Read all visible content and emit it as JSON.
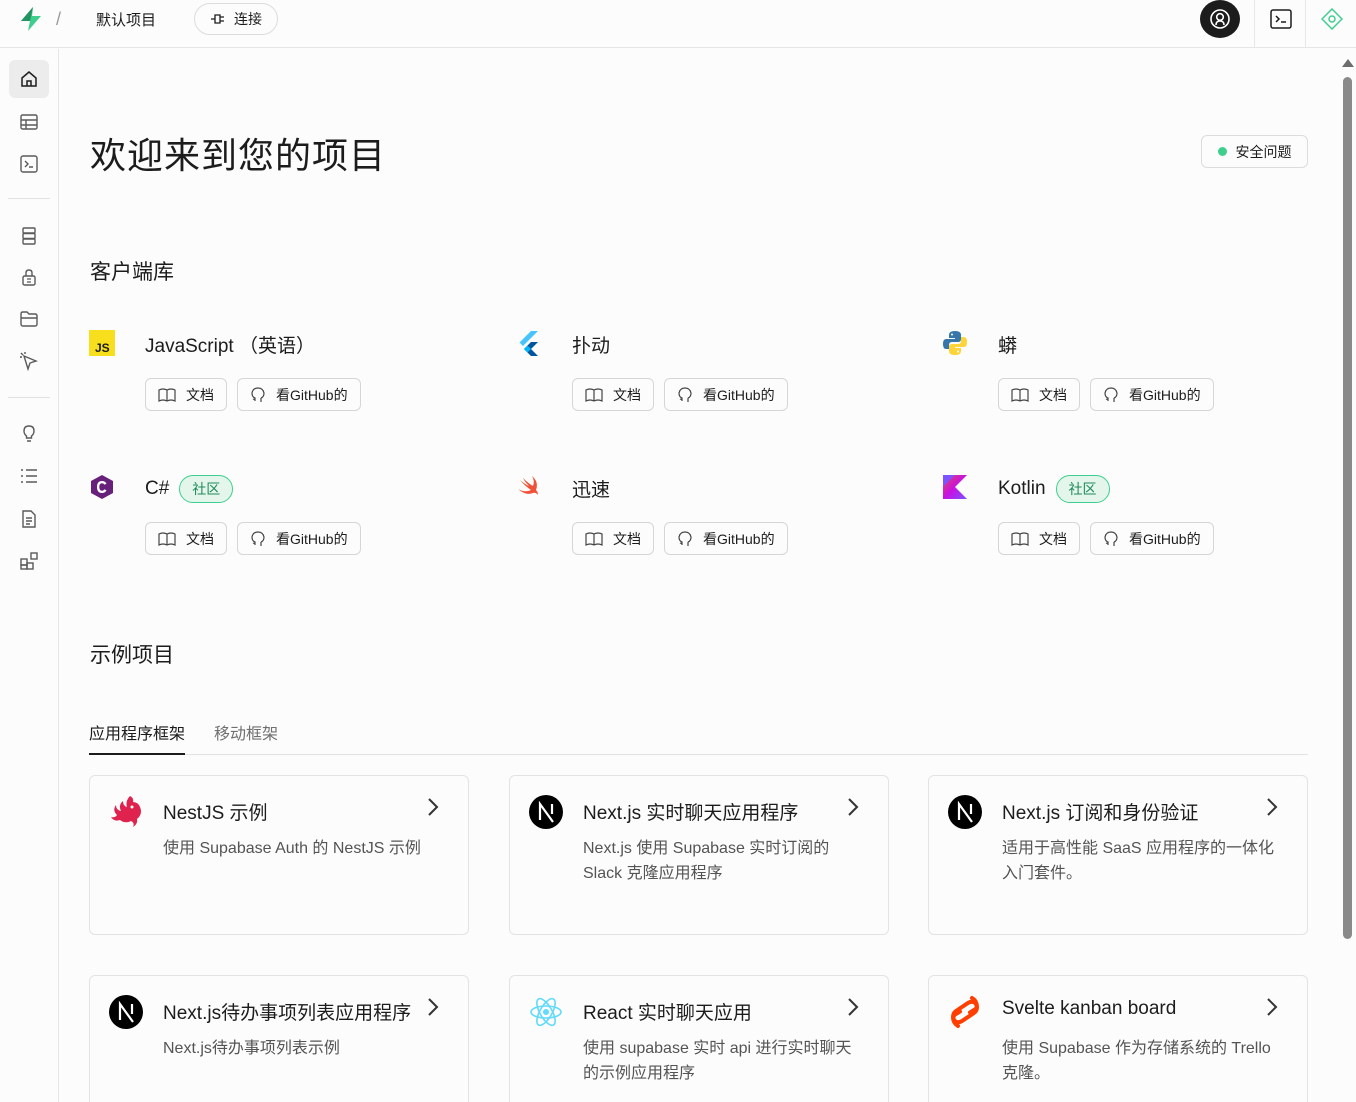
{
  "topbar": {
    "separator": "/",
    "project_name": "默认项目",
    "connect_label": "连接",
    "icons": [
      "supabase-logo",
      "plug-icon",
      "user-avatar-icon",
      "terminal-icon",
      "diamond-icon"
    ]
  },
  "sidebar": {
    "items": [
      {
        "name": "home",
        "icon": "home-icon",
        "active": true
      },
      {
        "name": "table-editor",
        "icon": "table-icon"
      },
      {
        "name": "sql-editor",
        "icon": "terminal-icon"
      },
      {
        "name": "database",
        "icon": "database-icon"
      },
      {
        "name": "authentication",
        "icon": "lock-icon"
      },
      {
        "name": "storage",
        "icon": "folder-icon"
      },
      {
        "name": "realtime",
        "icon": "cursor-icon"
      },
      {
        "name": "advisors",
        "icon": "lightbulb-icon"
      },
      {
        "name": "logs",
        "icon": "list-icon"
      },
      {
        "name": "api-docs",
        "icon": "document-icon"
      },
      {
        "name": "integrations",
        "icon": "blocks-icon"
      }
    ]
  },
  "main": {
    "title": "欢迎来到您的项目",
    "security_label": "安全问题",
    "client_libraries_title": "客户端库",
    "docs_label": "文档",
    "github_label": "看GitHub的",
    "community_label": "社区",
    "libraries": [
      {
        "name": "JavaScript （英语）",
        "icon": "javascript-icon",
        "community": false
      },
      {
        "name": "扑动",
        "icon": "flutter-icon",
        "community": false
      },
      {
        "name": "蟒",
        "icon": "python-icon",
        "community": false
      },
      {
        "name": "C#",
        "icon": "csharp-icon",
        "community": true
      },
      {
        "name": "迅速",
        "icon": "swift-icon",
        "community": false
      },
      {
        "name": "Kotlin",
        "icon": "kotlin-icon",
        "community": true
      }
    ],
    "examples_title": "示例项目",
    "tabs": [
      {
        "label": "应用程序框架",
        "active": true
      },
      {
        "label": "移动框架",
        "active": false
      }
    ],
    "examples": [
      {
        "title": "NestJS 示例",
        "desc": "使用 Supabase Auth 的 NestJS 示例",
        "icon": "nestjs-icon"
      },
      {
        "title": "Next.js 实时聊天应用程序",
        "desc": "Next.js 使用 Supabase 实时订阅的 Slack 克隆应用程序",
        "icon": "nextjs-icon"
      },
      {
        "title": "Next.js 订阅和身份验证",
        "desc": "适用于高性能 SaaS 应用程序的一体化入门套件。",
        "icon": "nextjs-icon"
      },
      {
        "title": "Next.js待办事项列表应用程序",
        "desc": "Next.js待办事项列表示例",
        "icon": "nextjs-icon"
      },
      {
        "title": "React 实时聊天应用",
        "desc": "使用 supabase 实时 api 进行实时聊天的示例应用程序",
        "icon": "react-icon"
      },
      {
        "title": "Svelte kanban board",
        "desc": "使用 Supabase 作为存储系统的 Trello 克隆。",
        "icon": "svelte-icon"
      }
    ]
  },
  "colors": {
    "brand": "#3ecf8e",
    "text": "#1c1c1c",
    "muted": "#545454",
    "border": "#e3e3e3"
  }
}
